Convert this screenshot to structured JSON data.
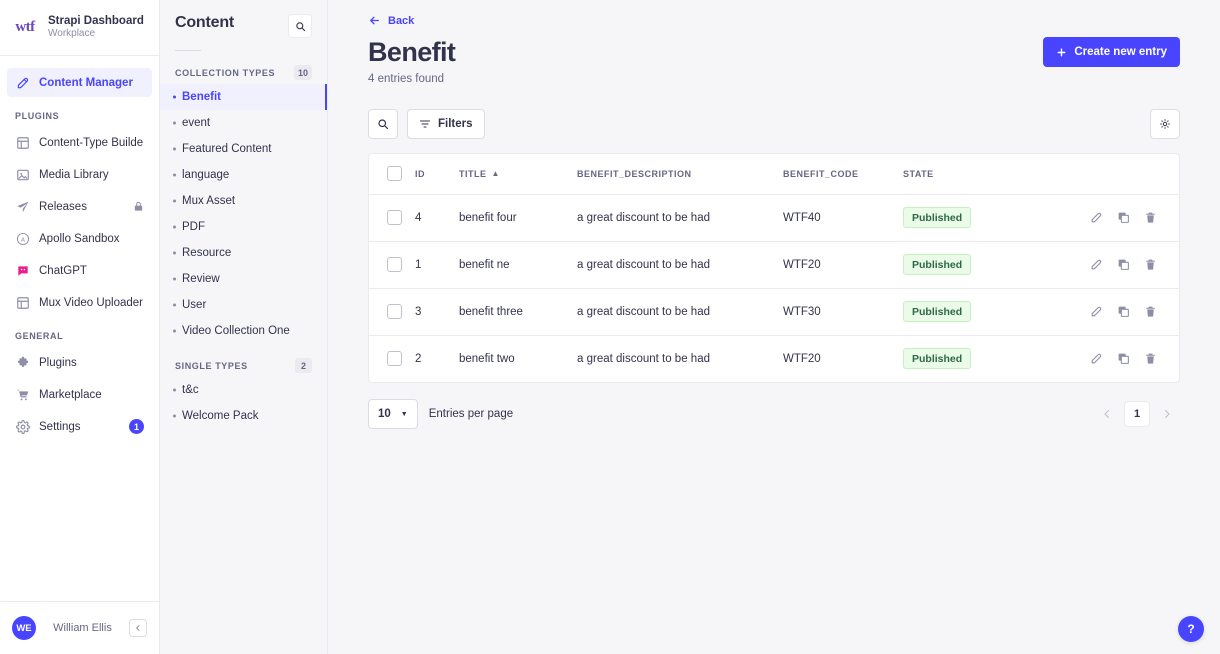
{
  "brand": {
    "logo_text": "wtf",
    "title": "Strapi Dashboard",
    "subtitle": "Workplace"
  },
  "sidebar": {
    "primary": [
      {
        "label": "Content Manager",
        "icon": "pencil-square-icon",
        "active": true
      }
    ],
    "sections": [
      {
        "label": "PLUGINS",
        "items": [
          {
            "label": "Content-Type Builder",
            "icon": "layout-icon"
          },
          {
            "label": "Media Library",
            "icon": "image-icon"
          },
          {
            "label": "Releases",
            "icon": "paper-plane-icon",
            "lock": true
          },
          {
            "label": "Apollo Sandbox",
            "icon": "apollo-circle-icon"
          },
          {
            "label": "ChatGPT",
            "icon": "chatgpt-icon"
          },
          {
            "label": "Mux Video Uploader",
            "icon": "layout-icon"
          }
        ]
      },
      {
        "label": "GENERAL",
        "items": [
          {
            "label": "Plugins",
            "icon": "puzzle-icon"
          },
          {
            "label": "Marketplace",
            "icon": "shopping-cart-icon"
          },
          {
            "label": "Settings",
            "icon": "gear-icon",
            "badge": "1"
          }
        ]
      }
    ],
    "user": {
      "initials": "WE",
      "name": "William Ellis",
      "collapse_icon": "chevron-left-icon"
    }
  },
  "content_panel": {
    "title": "Content",
    "search_icon": "search-icon",
    "groups": [
      {
        "label": "COLLECTION TYPES",
        "count": "10",
        "items": [
          {
            "label": "Benefit",
            "active": true
          },
          {
            "label": "event",
            "active": false
          },
          {
            "label": "Featured Content",
            "active": false
          },
          {
            "label": "language",
            "active": false
          },
          {
            "label": "Mux Asset",
            "active": false
          },
          {
            "label": "PDF",
            "active": false
          },
          {
            "label": "Resource",
            "active": false
          },
          {
            "label": "Review",
            "active": false
          },
          {
            "label": "User",
            "active": false
          },
          {
            "label": "Video Collection One",
            "active": false
          }
        ]
      },
      {
        "label": "SINGLE TYPES",
        "count": "2",
        "items": [
          {
            "label": "t&c",
            "active": false
          },
          {
            "label": "Welcome Pack",
            "active": false
          }
        ]
      }
    ]
  },
  "main": {
    "back_label": "Back",
    "back_icon": "arrow-left-icon",
    "title": "Benefit",
    "subtitle": "4 entries found",
    "create_button": {
      "label": "Create new entry",
      "icon": "plus-icon"
    },
    "toolbar": {
      "search_icon": "search-icon",
      "filters_label": "Filters",
      "filters_icon": "filter-icon",
      "settings_icon": "gear-icon"
    },
    "table": {
      "columns": [
        {
          "key": "id",
          "label": "ID",
          "sorted": false
        },
        {
          "key": "title",
          "label": "TITLE",
          "sorted": true,
          "sort_dir": "asc"
        },
        {
          "key": "benefit_description",
          "label": "BENEFIT_DESCRIPTION",
          "sorted": false
        },
        {
          "key": "benefit_code",
          "label": "BENEFIT_CODE",
          "sorted": false
        },
        {
          "key": "state",
          "label": "STATE",
          "sorted": false
        }
      ],
      "sort_arrow": "▲",
      "rows": [
        {
          "id": "4",
          "title": "benefit four",
          "benefit_description": "a great discount to be had",
          "benefit_code": "WTF40",
          "state": "Published"
        },
        {
          "id": "1",
          "title": "benefit ne",
          "benefit_description": "a great discount to be had",
          "benefit_code": "WTF20",
          "state": "Published"
        },
        {
          "id": "3",
          "title": "benefit three",
          "benefit_description": "a great discount to be had",
          "benefit_code": "WTF30",
          "state": "Published"
        },
        {
          "id": "2",
          "title": "benefit two",
          "benefit_description": "a great discount to be had",
          "benefit_code": "WTF20",
          "state": "Published"
        }
      ],
      "row_actions": [
        {
          "name": "edit-icon"
        },
        {
          "name": "duplicate-icon"
        },
        {
          "name": "delete-icon"
        }
      ]
    },
    "pagination": {
      "page_size": "10",
      "entries_label": "Entries per page",
      "prev_icon": "chevron-left-icon",
      "next_icon": "chevron-right-icon",
      "current_page": "1"
    },
    "help_label": "?"
  },
  "colors": {
    "accent": "#4945ff",
    "accent_soft": "#f0f0ff",
    "text": "#32324d",
    "muted": "#666687",
    "border": "#eaeaef",
    "page_bg": "#f6f6f9",
    "badge_bg": "#eafbe7",
    "badge_text": "#2f6846",
    "logo": "#6b44c8"
  }
}
